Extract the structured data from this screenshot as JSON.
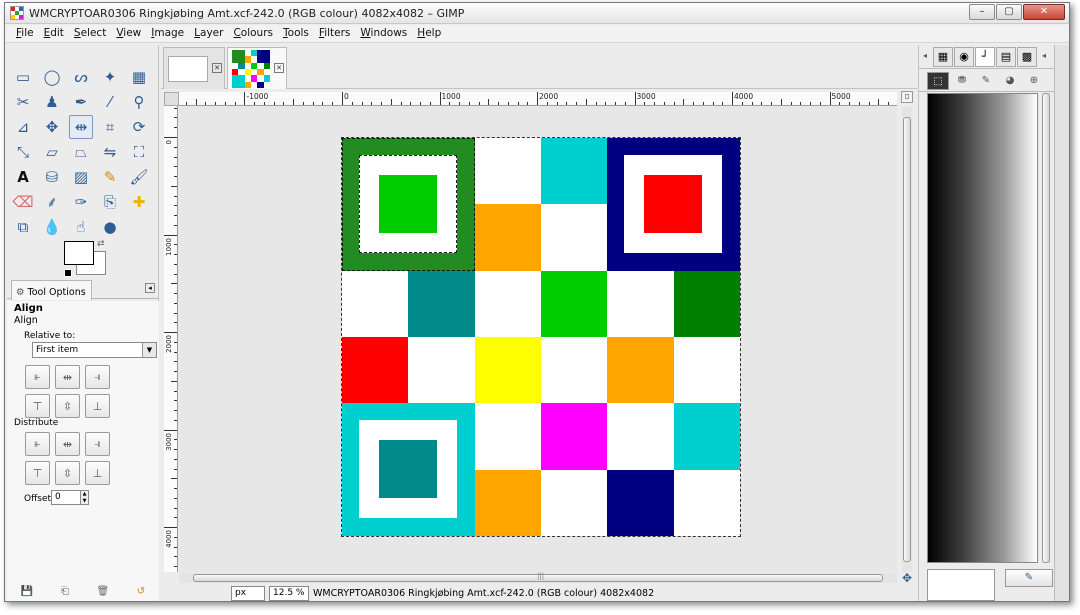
{
  "window": {
    "title": "WMCRYPTOAR0306 Ringkjøbing Amt.xcf-242.0 (RGB colour) 4082x4082 – GIMP",
    "controls": {
      "minimize": "–",
      "maximize": "▢",
      "close": "✕"
    }
  },
  "menu": [
    {
      "key": "F",
      "rest": "ile"
    },
    {
      "key": "E",
      "rest": "dit"
    },
    {
      "key": "S",
      "rest": "elect"
    },
    {
      "key": "V",
      "rest": "iew"
    },
    {
      "key": "I",
      "rest": "mage"
    },
    {
      "key": "L",
      "rest": "ayer"
    },
    {
      "key": "C",
      "rest": "olours"
    },
    {
      "key": "T",
      "rest": "ools"
    },
    {
      "key": "F",
      "rest": "ilters"
    },
    {
      "key": "W",
      "rest": "indows"
    },
    {
      "key": "H",
      "rest": "elp"
    }
  ],
  "tools": [
    {
      "name": "rect-select-icon",
      "glyph": "▭"
    },
    {
      "name": "ellipse-select-icon",
      "glyph": "◯"
    },
    {
      "name": "free-select-icon",
      "glyph": "ᔕ"
    },
    {
      "name": "fuzzy-select-icon",
      "glyph": "✦"
    },
    {
      "name": "color-select-icon",
      "glyph": "▦"
    },
    {
      "name": "scissors-icon",
      "glyph": "✂"
    },
    {
      "name": "foreground-select-icon",
      "glyph": "♟"
    },
    {
      "name": "paths-icon",
      "glyph": "✒"
    },
    {
      "name": "color-picker-icon",
      "glyph": "⁄"
    },
    {
      "name": "zoom-icon",
      "glyph": "⚲"
    },
    {
      "name": "measure-icon",
      "glyph": "⊿"
    },
    {
      "name": "move-icon",
      "glyph": "✥"
    },
    {
      "name": "align-icon",
      "glyph": "⇹"
    },
    {
      "name": "crop-icon",
      "glyph": "⌗"
    },
    {
      "name": "rotate-icon",
      "glyph": "⟳"
    },
    {
      "name": "scale-icon",
      "glyph": "⤡"
    },
    {
      "name": "shear-icon",
      "glyph": "▱"
    },
    {
      "name": "perspective-icon",
      "glyph": "⏢"
    },
    {
      "name": "flip-icon",
      "glyph": "⇋"
    },
    {
      "name": "cage-icon",
      "glyph": "⛶"
    },
    {
      "name": "text-icon",
      "glyph": "A"
    },
    {
      "name": "bucket-fill-icon",
      "glyph": "⛁"
    },
    {
      "name": "blend-icon",
      "glyph": "▨"
    },
    {
      "name": "pencil-icon",
      "glyph": "✎"
    },
    {
      "name": "paintbrush-icon",
      "glyph": "🖌"
    },
    {
      "name": "eraser-icon",
      "glyph": "⌫"
    },
    {
      "name": "airbrush-icon",
      "glyph": "⸙"
    },
    {
      "name": "ink-icon",
      "glyph": "✑"
    },
    {
      "name": "clone-icon",
      "glyph": "⎘"
    },
    {
      "name": "heal-icon",
      "glyph": "✚"
    },
    {
      "name": "perspective-clone-icon",
      "glyph": "⧉"
    },
    {
      "name": "blur-icon",
      "glyph": "💧"
    },
    {
      "name": "smudge-icon",
      "glyph": "☝"
    },
    {
      "name": "dodge-burn-icon",
      "glyph": "●"
    }
  ],
  "colors": {
    "foreground": "#ffffff",
    "background": "#ffffff"
  },
  "tool_options": {
    "tab_label": "Tool Options",
    "title": "Align",
    "subtitle": "Align",
    "relative_to_label": "Relative to:",
    "relative_to_value": "First item",
    "distribute_label": "Distribute",
    "offset_label": "Offset:",
    "offset_value": "0",
    "align_icons": [
      "align-left-edge-icon",
      "align-center-h-icon",
      "align-right-edge-icon",
      "align-top-edge-icon",
      "align-middle-v-icon",
      "align-bottom-edge-icon"
    ],
    "distribute_icons": [
      "distribute-left-icon",
      "distribute-center-h-icon",
      "distribute-right-icon",
      "distribute-top-icon",
      "distribute-middle-v-icon",
      "distribute-bottom-icon"
    ]
  },
  "ruler": {
    "h_labels": [
      "-1000",
      "0",
      "1000",
      "2000",
      "3000",
      "4000",
      "5000"
    ],
    "v_labels": [
      "0",
      "1000",
      "2000",
      "3000",
      "4000"
    ]
  },
  "image": {
    "grid": [
      [
        "#ffffff",
        "#ffffff",
        "#ffffff",
        "#00cfcf",
        "#ffffff",
        "#ffffff"
      ],
      [
        "#ffffff",
        "#ffffff",
        "#ffa500",
        "#ffffff",
        "#ffffff",
        "#ffffff"
      ],
      [
        "#ffffff",
        "#008b8b",
        "#ffffff",
        "#00cc00",
        "#ffffff",
        "#008000"
      ],
      [
        "#ff0000",
        "#ffffff",
        "#ffff00",
        "#ffffff",
        "#ffa500",
        "#ffffff"
      ],
      [
        "#ffffff",
        "#ffffff",
        "#ffffff",
        "#ff00ff",
        "#ffffff",
        "#00cfcf"
      ],
      [
        "#ffffff",
        "#ffffff",
        "#ffa500",
        "#ffffff",
        "#000080",
        "#ffffff"
      ]
    ],
    "finders": [
      {
        "pos": "top-left",
        "outer": "#228b22",
        "core": "#00cc00"
      },
      {
        "pos": "top-right",
        "outer": "#000080",
        "core": "#ff0000"
      },
      {
        "pos": "bottom-left",
        "outer": "#00cfcf",
        "core": "#008b8b"
      }
    ]
  },
  "status": {
    "unit": "px",
    "zoom": "12.5 %",
    "text": "WMCRYPTOAR0306 Ringkjøbing Amt.xcf-242.0 (RGB colour) 4082x4082"
  }
}
